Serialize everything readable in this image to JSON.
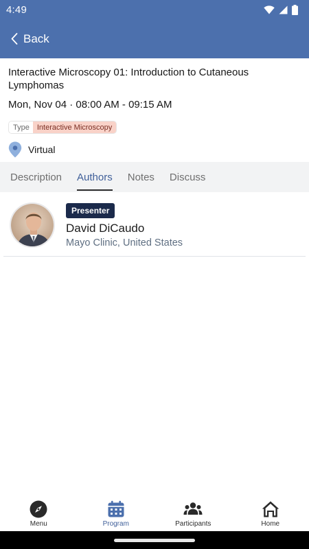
{
  "status_bar": {
    "time": "4:49"
  },
  "app_bar": {
    "back_label": "Back"
  },
  "session": {
    "title": "Interactive Microscopy 01: Introduction to Cutaneous Lymphomas",
    "datetime": "Mon, Nov 04 · 08:00 AM - 09:15 AM",
    "type_key": "Type",
    "type_value": "Interactive Microscopy",
    "location": "Virtual"
  },
  "tabs": [
    {
      "label": "Description",
      "active": false
    },
    {
      "label": "Authors",
      "active": true
    },
    {
      "label": "Notes",
      "active": false
    },
    {
      "label": "Discuss",
      "active": false
    }
  ],
  "authors": [
    {
      "role": "Presenter",
      "name": "David DiCaudo",
      "affiliation": "Mayo Clinic, United States"
    }
  ],
  "bottom_nav": [
    {
      "label": "Menu",
      "icon": "compass-icon",
      "active": false
    },
    {
      "label": "Program",
      "icon": "calendar-icon",
      "active": true
    },
    {
      "label": "Participants",
      "icon": "people-icon",
      "active": false
    },
    {
      "label": "Home",
      "icon": "home-icon",
      "active": false
    }
  ],
  "colors": {
    "header": "#4c70ad",
    "accent": "#3f5f99",
    "badge": "#1b2a4b",
    "type_tag": "#f9d2c8"
  }
}
